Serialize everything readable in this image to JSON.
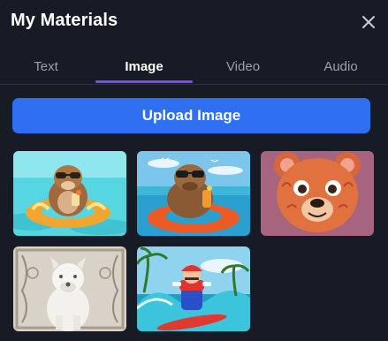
{
  "panel": {
    "title": "My Materials",
    "close_icon": "close-icon"
  },
  "tabs": [
    {
      "label": "Text",
      "active": false
    },
    {
      "label": "Image",
      "active": true
    },
    {
      "label": "Video",
      "active": false
    },
    {
      "label": "Audio",
      "active": false
    }
  ],
  "upload": {
    "label": "Upload Image"
  },
  "colors": {
    "background": "#161b26",
    "accent": "#2f6ff1",
    "tab_indicator": "#7c4dff"
  },
  "materials": [
    {
      "icon": "otter-sunglasses-float-thumbnail"
    },
    {
      "icon": "capybara-sunglasses-float-thumbnail"
    },
    {
      "icon": "bear-face-illustration-thumbnail"
    },
    {
      "icon": "white-dog-statue-thumbnail"
    },
    {
      "icon": "plumber-surfing-thumbnail"
    }
  ]
}
